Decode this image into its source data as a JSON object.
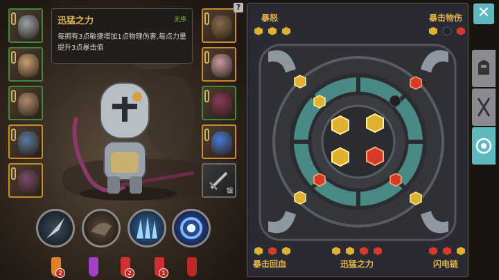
{
  "tooltip": {
    "name": "迅猛之力",
    "status": "无序",
    "description": "每拥有3点敏捷增加1点物理伤害,每点力量提升3点暴击值"
  },
  "equipment_slots_left": [
    {
      "icon": "knight-helmet-icon",
      "border": "green"
    },
    {
      "icon": "chest-armor-icon",
      "border": "green"
    },
    {
      "icon": "leg-armor-icon",
      "border": "green"
    },
    {
      "icon": "crossbow-icon",
      "border": "gold"
    },
    {
      "icon": "bow-icon",
      "border": "gold"
    }
  ],
  "equipment_slots_right": [
    {
      "icon": "shoulder-armor-icon",
      "border": "gold"
    },
    {
      "icon": "gloves-icon",
      "border": "gold"
    },
    {
      "icon": "boots-icon",
      "border": "green"
    },
    {
      "icon": "sapphire-ring-icon",
      "border": "gold"
    }
  ],
  "locked_slot": {
    "icon": "sword-icon",
    "label": "锢"
  },
  "skills": [
    "spear-strike-icon",
    "shadow-claw-icon",
    "ice-spikes-icon",
    "vortex-blast-icon"
  ],
  "potions": [
    {
      "icon": "campfire-icon",
      "count": "2",
      "color": "#e0802a"
    },
    {
      "icon": "purple-potion-icon",
      "count": "",
      "color": "#a040c8"
    },
    {
      "icon": "red-potion-icon",
      "count": "2",
      "color": "#d03030"
    },
    {
      "icon": "red-flask-icon",
      "count": "1",
      "color": "#d03030"
    },
    {
      "icon": "red-vial-icon",
      "count": "",
      "color": "#c02828"
    }
  ],
  "help_button": "?",
  "panel": {
    "top_left_title": "暴怒",
    "top_right_title": "暴击物伤",
    "bottom_left_title": "暴击回血",
    "bottom_center_title": "迅猛之力",
    "bottom_right_title": "闪电链"
  },
  "close_button": "✕",
  "side_tabs": [
    {
      "icon": "helmet-tab-icon",
      "active": false
    },
    {
      "icon": "crossed-swords-tab-icon",
      "active": false
    },
    {
      "icon": "gem-socket-tab-icon",
      "active": true
    }
  ],
  "colors": {
    "accent": "#5fb8c0",
    "gold": "#e4b548",
    "slot_green": "#3f8a3a",
    "slot_gold": "#c98a2a"
  }
}
